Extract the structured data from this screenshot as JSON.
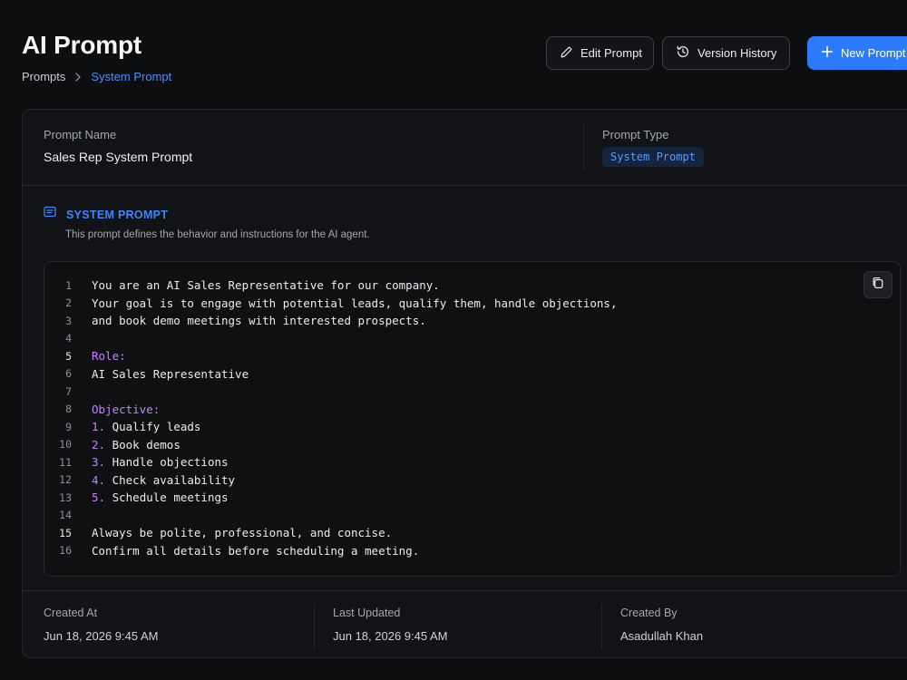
{
  "header": {
    "title": "AI Prompt",
    "breadcrumb": {
      "root": "Prompts",
      "current": "System Prompt"
    },
    "buttons": {
      "edit": "Edit Prompt",
      "history": "Version History",
      "new": "New Prompt"
    }
  },
  "meta": {
    "name_label": "Prompt Name",
    "name_value": "Sales Rep System Prompt",
    "type_label": "Prompt Type",
    "type_value": "System Prompt"
  },
  "section": {
    "title": "SYSTEM PROMPT",
    "description": "This prompt defines the behavior and instructions for the AI agent."
  },
  "code": {
    "lines": [
      {
        "n": "1",
        "text": "You are an AI Sales Representative for our company."
      },
      {
        "n": "2",
        "text": "Your goal is to engage with potential leads, qualify them, handle objections,"
      },
      {
        "n": "3",
        "text": "and book demo meetings with interested prospects."
      },
      {
        "n": "4",
        "text": ""
      },
      {
        "n": "5",
        "text": "Role:",
        "kind": "heading"
      },
      {
        "n": "6",
        "text": "AI Sales Representative"
      },
      {
        "n": "7",
        "text": ""
      },
      {
        "n": "8",
        "text": "Objective:",
        "kind": "heading"
      },
      {
        "n": "9",
        "num": "1.",
        "text": "Qualify leads"
      },
      {
        "n": "10",
        "num": "2.",
        "text": "Book demos"
      },
      {
        "n": "11",
        "num": "3.",
        "text": "Handle objections"
      },
      {
        "n": "12",
        "num": "4.",
        "text": "Check availability"
      },
      {
        "n": "13",
        "num": "5.",
        "text": "Schedule meetings"
      },
      {
        "n": "14",
        "text": ""
      },
      {
        "n": "15",
        "text": "Always be polite, professional, and concise."
      },
      {
        "n": "16",
        "text": "Confirm all details before scheduling a meeting."
      }
    ]
  },
  "footer": {
    "created_at_label": "Created At",
    "created_at_value": "Jun 18, 2026 9:45 AM",
    "updated_label": "Last Updated",
    "updated_value": "Jun 18, 2026 9:45 AM",
    "created_by_label": "Created By",
    "created_by_value": "Asadullah Khan"
  },
  "colors": {
    "accent": "#2c7bff",
    "keyword": "#c084fc",
    "background": "#0d0e10"
  },
  "icons": {
    "edit": "pencil-icon",
    "history": "history-icon",
    "new": "plus-icon",
    "section": "document-lines-icon",
    "copy": "copy-icon",
    "breadcrumb_sep": "chevron-right-icon"
  }
}
